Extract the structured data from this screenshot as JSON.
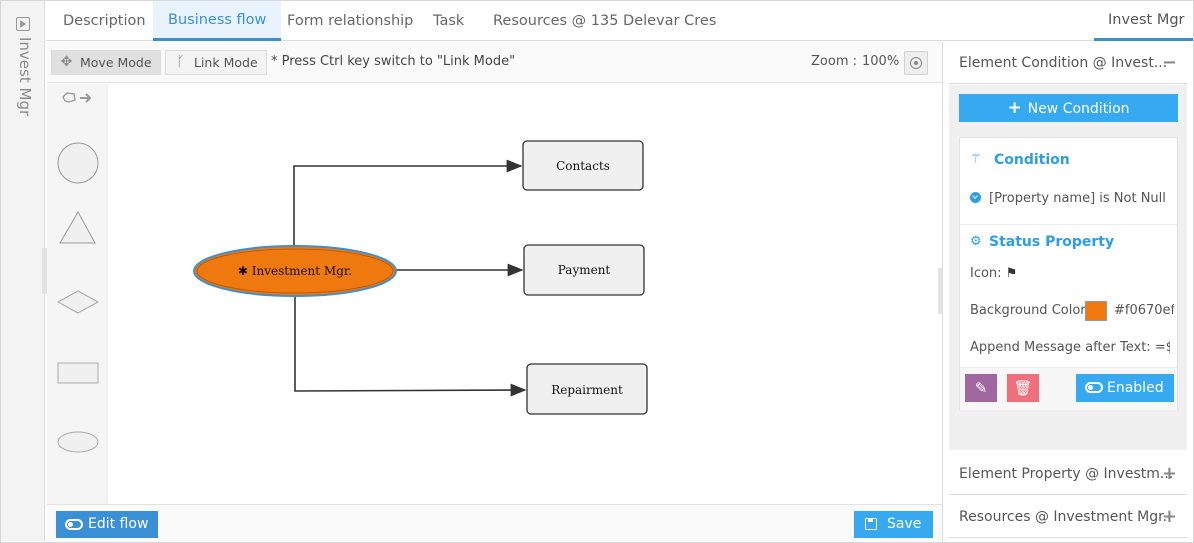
{
  "side_strip": {
    "label": "Invest Mgr"
  },
  "tabs": [
    {
      "label": "Description"
    },
    {
      "label": "Business flow"
    },
    {
      "label": "Form relationship"
    },
    {
      "label": "Task"
    },
    {
      "label": "Resources @ 135 Delevar Cres"
    }
  ],
  "right_tab": {
    "label": "Invest Mgr"
  },
  "toolbar": {
    "move_mode": "Move Mode",
    "link_mode": "Link Mode",
    "hint": "* Press Ctrl key switch to \"Link Mode\"",
    "zoom_label": "Zoom :",
    "zoom_value": "100%"
  },
  "flow": {
    "center_node": "✱ Investment Mgr.",
    "nodes": [
      "Contacts",
      "Payment",
      "Repairment"
    ],
    "center_color": "#f0790f",
    "center_border": "#3b8fd4"
  },
  "bottom": {
    "edit_flow": "Edit flow",
    "save": "Save"
  },
  "right_panel": {
    "condition_header": "Element Condition @ Invest...",
    "new_condition": "New Condition",
    "condition_title": "Condition",
    "condition_rule": "[Property name] is Not Null",
    "status_title": "Status Property",
    "icon_label": "Icon:",
    "bg_label": "Background Color:",
    "bg_value": "#f0670ef",
    "bg_swatch": "#f0790f",
    "append_label": "Append Message after Text: =${'P",
    "enabled": "Enabled",
    "property_header": "Element Property @ Investm...",
    "resources_header": "Resources @ Investment Mgr."
  }
}
